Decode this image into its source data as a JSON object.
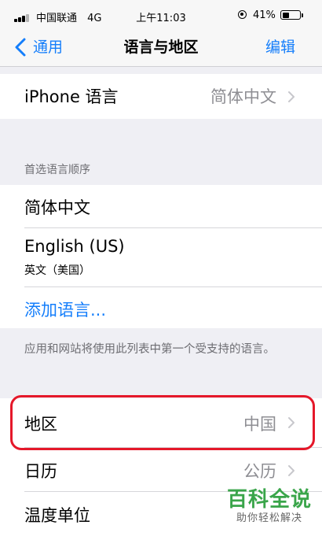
{
  "status_bar": {
    "carrier": "中国联通",
    "network": "4G",
    "time": "上午11:03",
    "battery_percent": "41%",
    "battery_level": 0.41
  },
  "nav": {
    "back_label": "通用",
    "title": "语言与地区",
    "edit_label": "编辑"
  },
  "iphone_language": {
    "label": "iPhone 语言",
    "value": "简体中文"
  },
  "preferred_languages": {
    "header": "首选语言顺序",
    "items": [
      {
        "label": "简体中文"
      },
      {
        "label": "English (US)",
        "subtitle": "英文（美国）"
      }
    ],
    "add_label": "添加语言...",
    "footer": "应用和网站将使用此列表中第一个受支持的语言。"
  },
  "region": {
    "label": "地区",
    "value": "中国"
  },
  "calendar": {
    "label": "日历",
    "value": "公历"
  },
  "temperature": {
    "label": "温度单位"
  },
  "watermark": {
    "title": "百科全说",
    "subtitle": "助你轻松解决"
  },
  "colors": {
    "accent": "#147efb",
    "highlight": "#e5182a",
    "watermark": "#3aa54a",
    "background": "#efeff4"
  }
}
